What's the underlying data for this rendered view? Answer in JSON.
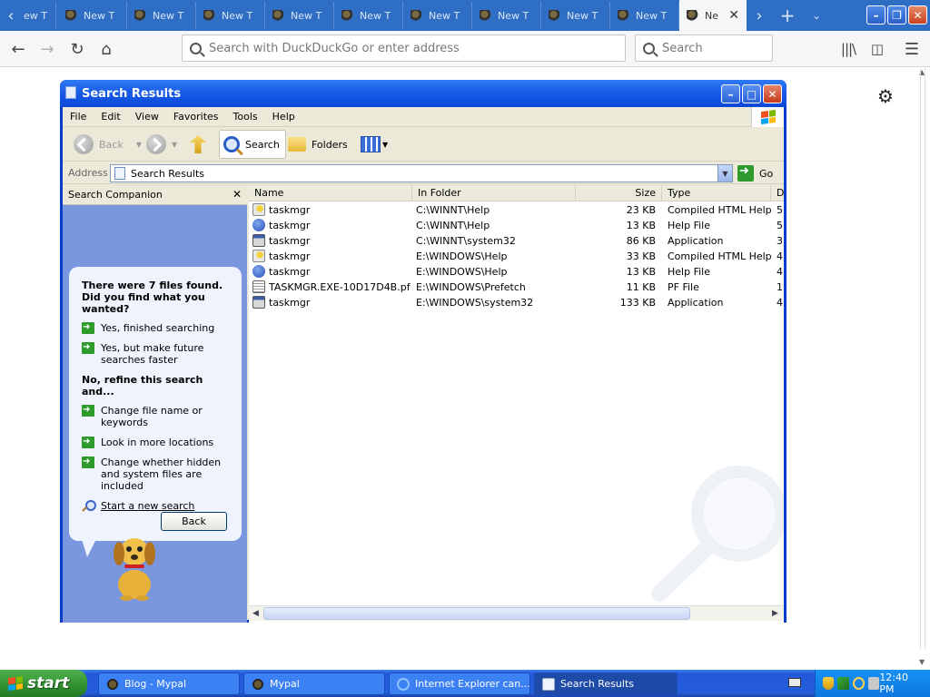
{
  "browser": {
    "tabs": [
      {
        "label": "ew T"
      },
      {
        "label": "New T"
      },
      {
        "label": "New T"
      },
      {
        "label": "New T"
      },
      {
        "label": "New T"
      },
      {
        "label": "New T"
      },
      {
        "label": "New T"
      },
      {
        "label": "New T"
      },
      {
        "label": "New T"
      },
      {
        "label": "New T"
      },
      {
        "label": "Ne",
        "active": true
      }
    ],
    "url_placeholder": "Search with DuckDuckGo or enter address",
    "search_placeholder": "Search"
  },
  "window": {
    "title": "Search Results",
    "menu": [
      "File",
      "Edit",
      "View",
      "Favorites",
      "Tools",
      "Help"
    ],
    "toolbar": {
      "back": "Back",
      "search": "Search",
      "folders": "Folders"
    },
    "address_label": "Address",
    "address_value": "Search Results",
    "go_label": "Go"
  },
  "companion": {
    "title": "Search Companion",
    "heading": "There were 7 files found. Did you find what you wanted?",
    "options_top": [
      "Yes, finished searching",
      "Yes, but make future searches faster"
    ],
    "refine_heading": "No, refine this search and...",
    "options_refine": [
      "Change file name or keywords",
      "Look in more locations",
      "Change whether hidden and system files are included"
    ],
    "new_search": "Start a new search",
    "back_button": "Back"
  },
  "filelist": {
    "columns": [
      "Name",
      "In Folder",
      "Size",
      "Type",
      "D"
    ],
    "rows": [
      {
        "icon": "chm",
        "name": "taskmgr",
        "folder": "C:\\WINNT\\Help",
        "size": "23 KB",
        "type": "Compiled HTML Help...",
        "extra": "5"
      },
      {
        "icon": "hlp",
        "name": "taskmgr",
        "folder": "C:\\WINNT\\Help",
        "size": "13 KB",
        "type": "Help File",
        "extra": "5"
      },
      {
        "icon": "app",
        "name": "taskmgr",
        "folder": "C:\\WINNT\\system32",
        "size": "86 KB",
        "type": "Application",
        "extra": "3"
      },
      {
        "icon": "chm",
        "name": "taskmgr",
        "folder": "E:\\WINDOWS\\Help",
        "size": "33 KB",
        "type": "Compiled HTML Help...",
        "extra": "4"
      },
      {
        "icon": "hlp",
        "name": "taskmgr",
        "folder": "E:\\WINDOWS\\Help",
        "size": "13 KB",
        "type": "Help File",
        "extra": "4"
      },
      {
        "icon": "pf",
        "name": "TASKMGR.EXE-10D17D4B.pf",
        "folder": "E:\\WINDOWS\\Prefetch",
        "size": "11 KB",
        "type": "PF File",
        "extra": "1"
      },
      {
        "icon": "app",
        "name": "taskmgr",
        "folder": "E:\\WINDOWS\\system32",
        "size": "133 KB",
        "type": "Application",
        "extra": "4"
      }
    ]
  },
  "taskbar": {
    "start_label": "start",
    "tasks": [
      {
        "label": "Blog - Mypal"
      },
      {
        "label": "Mypal"
      },
      {
        "label": "Internet Explorer can..."
      },
      {
        "label": "Search Results",
        "active": true
      }
    ],
    "clock": "12:40 PM"
  },
  "colors": {
    "xp_blue": "#0b47d8",
    "companion_bg": "#7a96df",
    "taskbar_blue": "#245edb",
    "start_green": "#2f8f2f"
  }
}
